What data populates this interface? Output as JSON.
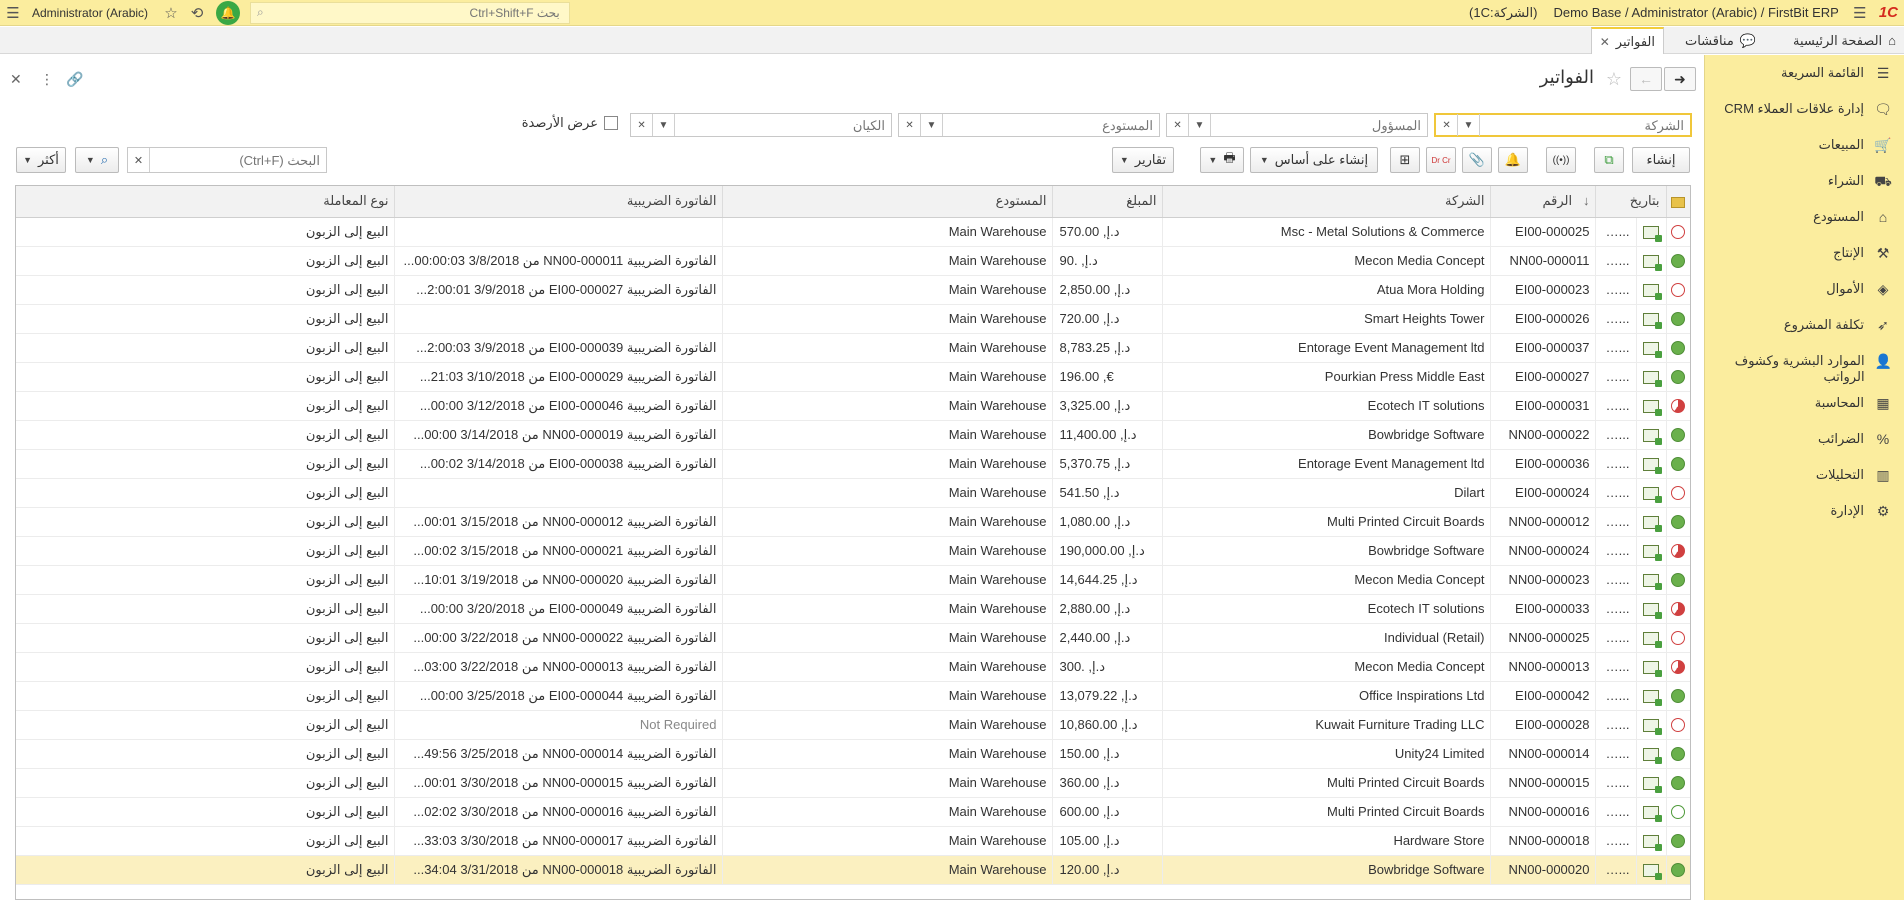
{
  "topbar": {
    "app_title": "Demo Base / Administrator (Arabic) / FirstBit ERP",
    "company_tag": "(1C:الشركة)",
    "user_name": "Administrator (Arabic)",
    "search_placeholder": "بحث Ctrl+Shift+F",
    "logo": "1C"
  },
  "tabs": {
    "home": "الصفحة الرئيسية",
    "discussions": "مناقشات",
    "invoices": "الفواتير"
  },
  "sidebar": {
    "items": [
      {
        "label": "القائمة السريعة",
        "icon": "menu-icon"
      },
      {
        "label": "إدارة علاقات العملاء CRM",
        "icon": "chat-icon"
      },
      {
        "label": "المبيعات",
        "icon": "basket-icon"
      },
      {
        "label": "الشراء",
        "icon": "truck-icon"
      },
      {
        "label": "المستودع",
        "icon": "warehouse-icon"
      },
      {
        "label": "الإنتاج",
        "icon": "factory-icon"
      },
      {
        "label": "الأموال",
        "icon": "money-icon"
      },
      {
        "label": "تكلفة المشروع",
        "icon": "rocket-icon"
      },
      {
        "label": "الموارد البشرية وكشوف الرواتب",
        "icon": "person-icon"
      },
      {
        "label": "المحاسبة",
        "icon": "calculator-icon"
      },
      {
        "label": "الضرائب",
        "icon": "percent-icon"
      },
      {
        "label": "التحليلات",
        "icon": "chart-icon"
      },
      {
        "label": "الإدارة",
        "icon": "gear-icon"
      }
    ]
  },
  "page": {
    "title": "الفواتير"
  },
  "filters": {
    "company_placeholder": "الشركة",
    "responsible_placeholder": "المسؤول",
    "warehouse_placeholder": "المستودع",
    "entity_placeholder": "الكيان",
    "show_balances": "عرض الأرصدة"
  },
  "toolbar": {
    "create": "إنشاء",
    "create_based_on": "إنشاء على أساس",
    "reports": "تقارير",
    "search_placeholder": "البحث (Ctrl+F)",
    "more": "أكثر",
    "dr_cr": "Dr Cr"
  },
  "table": {
    "columns": {
      "date": "بتاريخ",
      "number": "الرقم",
      "company": "الشركة",
      "amount": "المبلغ",
      "warehouse": "المستودع",
      "tax_invoice": "الفاتورة الضريبية",
      "operation": "نوع المعاملة"
    },
    "rows": [
      {
        "status": "red-ring",
        "date": "...018",
        "number": "EI00-000025",
        "company": "Msc - Metal Solutions & Commerce",
        "amount": "570.00 ,د.إ",
        "warehouse": "Main Warehouse",
        "tax_invoice": "",
        "operation": "البيع إلى الزبون"
      },
      {
        "status": "green",
        "date": "...018",
        "number": "NN00-000011",
        "company": "Mecon Media Concept",
        "amount": "90. ,د.إ",
        "warehouse": "Main Warehouse",
        "tax_invoice": "الفاتورة الضريبية NN00-000011 من 3/8/2018 00:00:03...",
        "operation": "البيع إلى الزبون"
      },
      {
        "status": "red-ring",
        "date": "...018",
        "number": "EI00-000023",
        "company": "Atua Mora Holding",
        "amount": "2,850.00 ,د.إ",
        "warehouse": "Main Warehouse",
        "tax_invoice": "الفاتورة الضريبية EI00-000027 من 3/9/2018 2:00:01...",
        "operation": "البيع إلى الزبون"
      },
      {
        "status": "green",
        "date": "...018",
        "number": "EI00-000026",
        "company": "Smart Heights Tower",
        "amount": "720.00 ,د.إ",
        "warehouse": "Main Warehouse",
        "tax_invoice": "",
        "operation": "البيع إلى الزبون"
      },
      {
        "status": "green",
        "date": "...018",
        "number": "EI00-000037",
        "company": "Entorage Event Management ltd",
        "amount": "8,783.25 ,د.إ",
        "warehouse": "Main Warehouse",
        "tax_invoice": "الفاتورة الضريبية EI00-000039 من 3/9/2018 2:00:03...",
        "operation": "البيع إلى الزبون"
      },
      {
        "status": "green",
        "date": "...018",
        "number": "EI00-000027",
        "company": "Pourkian Press Middle East",
        "amount": "196.00 ,€",
        "warehouse": "Main Warehouse",
        "tax_invoice": "الفاتورة الضريبية EI00-000029 من 3/10/2018 21:03...",
        "operation": "البيع إلى الزبون"
      },
      {
        "status": "red-pie",
        "date": "...018",
        "number": "EI00-000031",
        "company": "Ecotech IT solutions",
        "amount": "3,325.00 ,د.إ",
        "warehouse": "Main Warehouse",
        "tax_invoice": "الفاتورة الضريبية EI00-000046 من 3/12/2018 00:00...",
        "operation": "البيع إلى الزبون"
      },
      {
        "status": "green",
        "date": "...018",
        "number": "NN00-000022",
        "company": "Bowbridge Software",
        "amount": "11,400.00 ,د.إ",
        "warehouse": "Main Warehouse",
        "tax_invoice": "الفاتورة الضريبية NN00-000019 من 3/14/2018 00:00...",
        "operation": "البيع إلى الزبون"
      },
      {
        "status": "green",
        "date": "...018",
        "number": "EI00-000036",
        "company": "Entorage Event Management ltd",
        "amount": "5,370.75 ,د.إ",
        "warehouse": "Main Warehouse",
        "tax_invoice": "الفاتورة الضريبية EI00-000038 من 3/14/2018 00:02...",
        "operation": "البيع إلى الزبون"
      },
      {
        "status": "red-ring",
        "date": "...018",
        "number": "EI00-000024",
        "company": "Dilart",
        "amount": "541.50 ,د.إ",
        "warehouse": "Main Warehouse",
        "tax_invoice": "",
        "operation": "البيع إلى الزبون"
      },
      {
        "status": "green",
        "date": "...018",
        "number": "NN00-000012",
        "company": "Multi Printed Circuit Boards",
        "amount": "1,080.00 ,د.إ",
        "warehouse": "Main Warehouse",
        "tax_invoice": "الفاتورة الضريبية NN00-000012 من 3/15/2018 00:01...",
        "operation": "البيع إلى الزبون"
      },
      {
        "status": "red-pie",
        "date": "...018",
        "number": "NN00-000024",
        "company": "Bowbridge Software",
        "amount": "190,000.00 ,د.إ",
        "warehouse": "Main Warehouse",
        "tax_invoice": "الفاتورة الضريبية NN00-000021 من 3/15/2018 00:02...",
        "operation": "البيع إلى الزبون"
      },
      {
        "status": "green",
        "date": "...018",
        "number": "NN00-000023",
        "company": "Mecon Media Concept",
        "amount": "14,644.25 ,د.إ",
        "warehouse": "Main Warehouse",
        "tax_invoice": "الفاتورة الضريبية NN00-000020 من 3/19/2018 10:01...",
        "operation": "البيع إلى الزبون"
      },
      {
        "status": "red-pie",
        "date": "...018",
        "number": "EI00-000033",
        "company": "Ecotech IT solutions",
        "amount": "2,880.00 ,د.إ",
        "warehouse": "Main Warehouse",
        "tax_invoice": "الفاتورة الضريبية EI00-000049 من 3/20/2018 00:00...",
        "operation": "البيع إلى الزبون"
      },
      {
        "status": "red-ring",
        "date": "...018",
        "number": "NN00-000025",
        "company": "Individual (Retail)",
        "amount": "2,440.00 ,د.إ",
        "warehouse": "Main Warehouse",
        "tax_invoice": "الفاتورة الضريبية NN00-000022 من 3/22/2018 00:00...",
        "operation": "البيع إلى الزبون"
      },
      {
        "status": "red-pie",
        "date": "...018",
        "number": "NN00-000013",
        "company": "Mecon Media Concept",
        "amount": "300. ,د.إ",
        "warehouse": "Main Warehouse",
        "tax_invoice": "الفاتورة الضريبية NN00-000013 من 3/22/2018 03:00...",
        "operation": "البيع إلى الزبون"
      },
      {
        "status": "green",
        "date": "...018",
        "number": "EI00-000042",
        "company": "Office Inspirations Ltd",
        "amount": "13,079.22 ,د.إ",
        "warehouse": "Main Warehouse",
        "tax_invoice": "الفاتورة الضريبية EI00-000044 من 3/25/2018 00:00...",
        "operation": "البيع إلى الزبون"
      },
      {
        "status": "red-ring",
        "date": "...018",
        "number": "EI00-000028",
        "company": "Kuwait Furniture Trading LLC",
        "amount": "10,860.00 ,د.إ",
        "warehouse": "Main Warehouse",
        "tax_invoice": "Not Required",
        "operation": "البيع إلى الزبون"
      },
      {
        "status": "green",
        "date": "...018",
        "number": "NN00-000014",
        "company": "Unity24 Limited",
        "amount": "150.00 ,د.إ",
        "warehouse": "Main Warehouse",
        "tax_invoice": "الفاتورة الضريبية NN00-000014 من 3/25/2018 49:56...",
        "operation": "البيع إلى الزبون"
      },
      {
        "status": "green",
        "date": "...018",
        "number": "NN00-000015",
        "company": "Multi Printed Circuit Boards",
        "amount": "360.00 ,د.إ",
        "warehouse": "Main Warehouse",
        "tax_invoice": "الفاتورة الضريبية NN00-000015 من 3/30/2018 00:01...",
        "operation": "البيع إلى الزبون"
      },
      {
        "status": "green-ring",
        "date": "...018",
        "number": "NN00-000016",
        "company": "Multi Printed Circuit Boards",
        "amount": "600.00 ,د.إ",
        "warehouse": "Main Warehouse",
        "tax_invoice": "الفاتورة الضريبية NN00-000016 من 3/30/2018 02:02...",
        "operation": "البيع إلى الزبون"
      },
      {
        "status": "green",
        "date": "...018",
        "number": "NN00-000018",
        "company": "Hardware Store",
        "amount": "105.00 ,د.إ",
        "warehouse": "Main Warehouse",
        "tax_invoice": "الفاتورة الضريبية NN00-000017 من 3/30/2018 33:03...",
        "operation": "البيع إلى الزبون"
      },
      {
        "status": "green",
        "date": "...018",
        "number": "NN00-000020",
        "company": "Bowbridge Software",
        "amount": "120.00 ,د.إ",
        "warehouse": "Main Warehouse",
        "tax_invoice": "الفاتورة الضريبية NN00-000018 من 3/31/2018 34:04...",
        "operation": "البيع إلى الزبون",
        "selected": true
      }
    ]
  }
}
